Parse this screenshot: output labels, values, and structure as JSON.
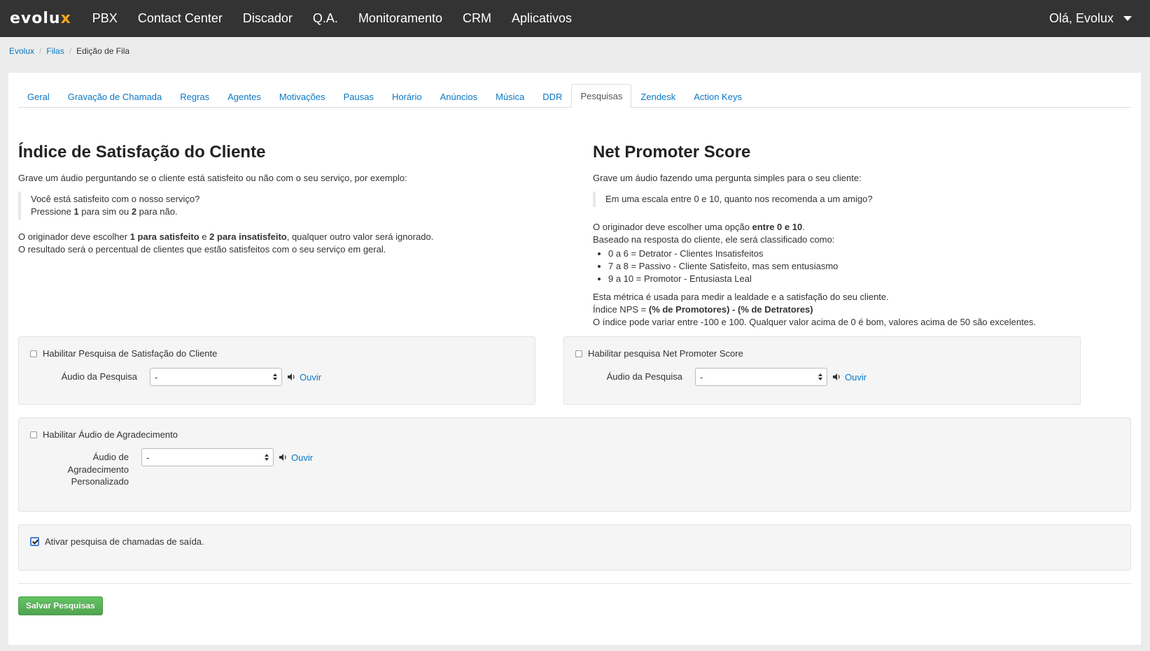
{
  "nav": {
    "brand_main": "evolu",
    "brand_accent": "x",
    "items": [
      "PBX",
      "Contact Center",
      "Discador",
      "Q.A.",
      "Monitoramento",
      "CRM",
      "Aplicativos"
    ],
    "user": "Olá, Evolux"
  },
  "breadcrumb": {
    "items": [
      "Evolux",
      "Filas",
      "Edição de Fila"
    ]
  },
  "tabs": {
    "items": [
      "Geral",
      "Gravação de Chamada",
      "Regras",
      "Agentes",
      "Motivações",
      "Pausas",
      "Horário",
      "Anúncios",
      "Música",
      "DDR",
      "Pesquisas",
      "Zendesk",
      "Action Keys"
    ],
    "active": "Pesquisas"
  },
  "csi": {
    "title": "Índice de Satisfação do Cliente",
    "intro": "Grave um áudio perguntando se o cliente está satisfeito ou não com o seu serviço, por exemplo:",
    "quote_line1": "Você está satisfeito com o nosso serviço?",
    "quote_l2_a": "Pressione ",
    "quote_l2_b": "1",
    "quote_l2_c": " para sim ou ",
    "quote_l2_d": "2",
    "quote_l2_e": " para não.",
    "p1_a": "O originador deve escolher ",
    "p1_b": "1 para satisfeito",
    "p1_c": " e ",
    "p1_d": "2 para insatisfeito",
    "p1_e": ", qualquer outro valor será ignorado.",
    "p2": "O resultado será o percentual de clientes que estão satisfeitos com o seu serviço em geral.",
    "enable_label": "Habilitar Pesquisa de Satisfação do Cliente",
    "audio_label": "Áudio da Pesquisa",
    "audio_value": "-",
    "listen": "Ouvir"
  },
  "nps": {
    "title": "Net Promoter Score",
    "intro": "Grave um áudio fazendo uma pergunta simples para o seu cliente:",
    "quote": "Em uma escala entre 0 e 10, quanto nos recomenda a um amigo?",
    "p1_a": "O originador deve escolher uma opção ",
    "p1_b": "entre 0 e 10",
    "p1_c": ".",
    "p2": "Baseado na resposta do cliente, ele será classificado como:",
    "classes": [
      "0 a 6 = Detrator - Clientes Insatisfeitos",
      "7 a 8 = Passivo - Cliente Satisfeito, mas sem entusiasmo",
      "9 a 10 = Promotor - Entusiasta Leal"
    ],
    "p3": "Esta métrica é usada para medir a lealdade e a satisfação do seu cliente.",
    "p4_a": "Índice NPS = ",
    "p4_b": "(% de Promotores) - (% de Detratores)",
    "p5": "O índice pode variar entre -100 e 100. Qualquer valor acima de 0 é bom, valores acima de 50 são excelentes.",
    "enable_label": "Habilitar pesquisa Net Promoter Score",
    "audio_label": "Áudio da Pesquisa",
    "audio_value": "-",
    "listen": "Ouvir"
  },
  "thanks": {
    "enable_label": "Habilitar Áudio de Agradecimento",
    "audio_label_l1": "Áudio de",
    "audio_label_l2": "Agradecimento",
    "audio_label_l3": "Personalizado",
    "audio_value": "-",
    "listen": "Ouvir"
  },
  "outbound": {
    "label": "Ativar pesquisa de chamadas de saída.",
    "checked": true
  },
  "save_button": "Salvar Pesquisas",
  "colors": {
    "navbar": "#333333",
    "link": "#0a77c4",
    "brand_accent": "#f0a51b",
    "save_button": "#5bb75b"
  }
}
